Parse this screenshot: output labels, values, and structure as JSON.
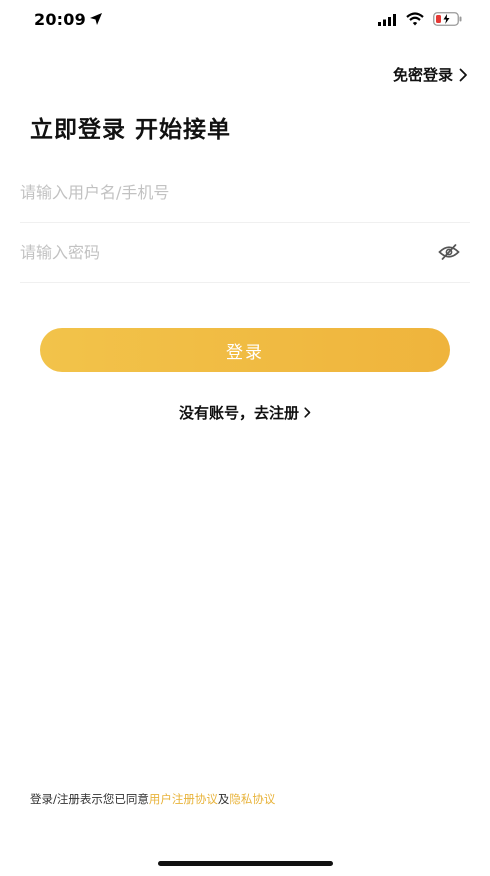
{
  "status_bar": {
    "time": "20:09",
    "icons": [
      "location-arrow-icon",
      "signal-icon",
      "wifi-icon",
      "battery-charging-icon"
    ]
  },
  "header": {
    "quick_login_label": "免密登录"
  },
  "title": "立即登录 开始接单",
  "form": {
    "username_placeholder": "请输入用户名/手机号",
    "password_placeholder": "请输入密码",
    "login_button": "登录"
  },
  "register_link": "没有账号，去注册",
  "agreement": {
    "prefix": "登录/注册表示您已同意",
    "user_agreement": "用户注册协议",
    "and": "及",
    "privacy_policy": "隐私协议"
  },
  "colors": {
    "accent": "#efb43c",
    "link": "#e8b33a",
    "battery_red": "#e53935"
  }
}
